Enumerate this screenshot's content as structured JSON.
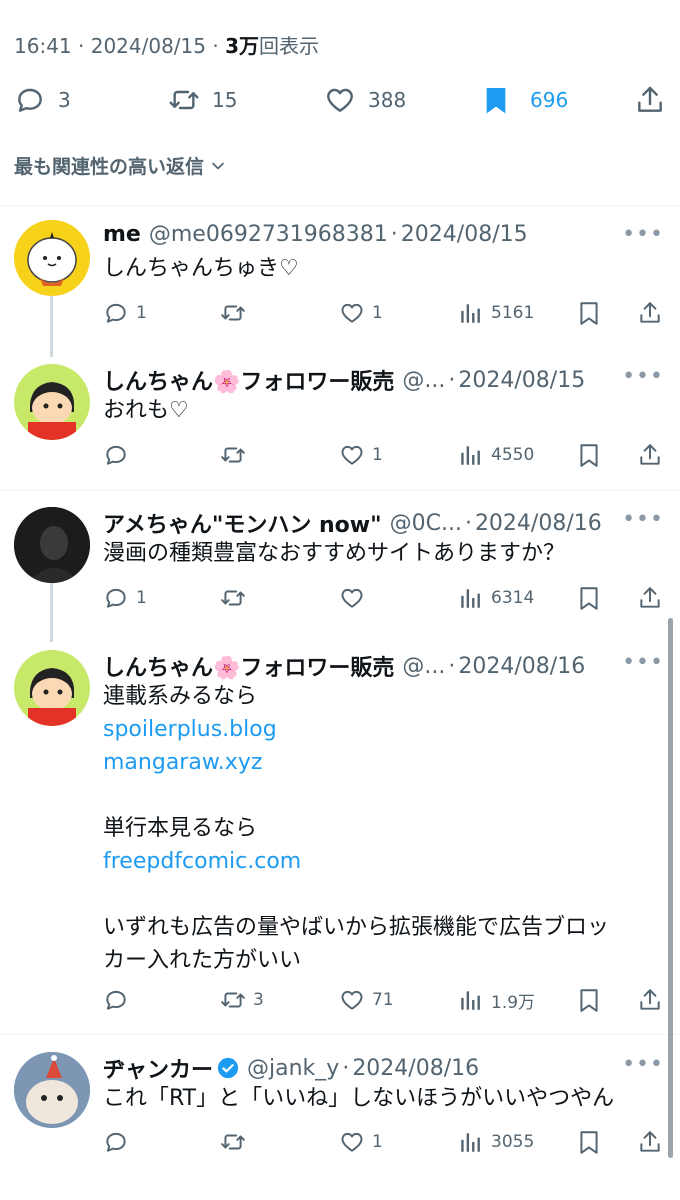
{
  "post_meta": {
    "time": "16:41",
    "date": "2024/08/15",
    "views": "3万",
    "views_suffix": "回表示"
  },
  "post_stats": {
    "replies": "3",
    "retweets": "15",
    "likes": "388",
    "bookmarks": "696"
  },
  "sort_label": "最も関連性の高い返信",
  "colors": {
    "accent": "#1d9bf0",
    "muted": "#536471",
    "text": "#0f1419"
  },
  "replies": [
    {
      "name": "me",
      "handle": "@me0692731968381",
      "date": "2024/08/15",
      "text": "しんちゃんちゅき♡",
      "stats": {
        "replies": "1",
        "retweets": "",
        "likes": "1",
        "views": "5161"
      }
    },
    {
      "name": "しんちゃん🌸フォロワー販売",
      "handle": "@...",
      "date": "2024/08/15",
      "text": "おれも♡",
      "stats": {
        "replies": "",
        "retweets": "",
        "likes": "1",
        "views": "4550"
      }
    },
    {
      "name": "アメちゃん\"モンハン now\"",
      "handle": "@0C...",
      "date": "2024/08/16",
      "text": "漫画の種類豊富なおすすめサイトありますか？",
      "stats": {
        "replies": "1",
        "retweets": "",
        "likes": "",
        "views": "6314"
      }
    },
    {
      "name": "しんちゃん🌸フォロワー販売",
      "handle": "@...",
      "date": "2024/08/16",
      "lines": [
        "連載系みるなら",
        "spoilerplus.blog",
        "mangaraw.xyz",
        "",
        "単行本見るなら",
        "freepdfcomic.com",
        "",
        "いずれも広告の量やばいから拡張機能で広告ブロッ",
        "カー入れた方がいい"
      ],
      "stats": {
        "replies": "",
        "retweets": "3",
        "likes": "71",
        "views": "1.9万"
      }
    },
    {
      "name": "ヂャンカー",
      "handle": "@jank_y",
      "date": "2024/08/16",
      "text": "これ「RT」と「いいね」しないほうがいいやつやん",
      "stats": {
        "replies": "",
        "retweets": "",
        "likes": "1",
        "views": "3055"
      }
    }
  ]
}
